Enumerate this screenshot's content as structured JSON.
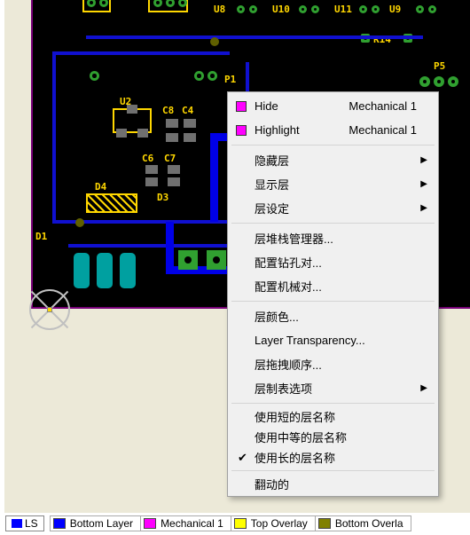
{
  "pcb": {
    "designators": {
      "u2": "U2",
      "u8": "U8",
      "u9": "U9",
      "u10": "U10",
      "u11": "U11",
      "r14": "R14",
      "p5": "P5",
      "c6": "C6",
      "c7": "C7",
      "c8": "C8",
      "c4": "C4",
      "d1": "D1",
      "d3": "D3",
      "d4": "D4",
      "p1": "P1",
      "d1b": "D1"
    }
  },
  "menu": {
    "hide": {
      "label": "Hide",
      "target": "Mechanical 1",
      "color": "#ff00ff"
    },
    "highlight": {
      "label": "Highlight",
      "target": "Mechanical 1",
      "color": "#ff00ff"
    },
    "hide_layers": "隐藏层",
    "show_layers": "显示层",
    "layer_settings": "层设定",
    "layer_stack_manager": "层堆栈管理器...",
    "configure_drill_pairs": "配置钻孔对...",
    "configure_mech_pairs": "配置机械对...",
    "layer_colors": "层颜色...",
    "layer_transparency": "Layer Transparency...",
    "layer_drag_order": "层拖拽顺序...",
    "layer_tab_options": "层制表选项",
    "use_short_names": "使用短的层名称",
    "use_med_names": "使用中等的层名称",
    "use_long_names": "使用长的层名称",
    "flipping": "翻动的",
    "check": "✔",
    "arrow": "▶"
  },
  "tabs": {
    "ls": "LS",
    "bottom": {
      "label": "Bottom Layer",
      "color": "#0000ff"
    },
    "mech1": {
      "label": "Mechanical 1",
      "color": "#ff00ff"
    },
    "top_overlay": {
      "label": "Top Overlay",
      "color": "#ffff00"
    },
    "bottom_overlay": {
      "label": "Bottom Overla",
      "color": "#808000"
    }
  }
}
